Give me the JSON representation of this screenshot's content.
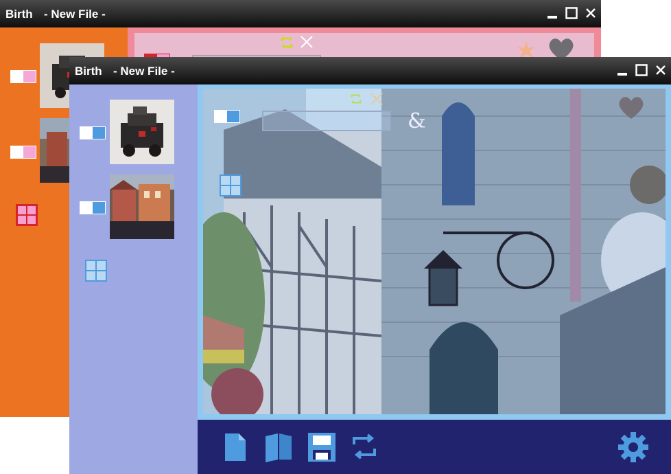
{
  "back_window": {
    "app_name": "Birth",
    "file_name": "- New File -"
  },
  "front_window": {
    "app_name": "Birth",
    "file_name": "- New File -",
    "search_field": {
      "value": "",
      "placeholder": ""
    },
    "amp_label": "&"
  },
  "icons": {
    "window_controls": [
      "minimize-icon",
      "maximize-icon",
      "close-icon"
    ],
    "toolbar": [
      "new-page-icon",
      "open-book-icon",
      "save-icon",
      "refresh-icon",
      "settings-gear-icon"
    ],
    "overlay": [
      "refresh-icon",
      "close-icon",
      "heart-icon"
    ]
  },
  "colors": {
    "back_accent": "#ec7322",
    "back_content": "#f08a98",
    "front_sidebar": "#9ea8e2",
    "front_content_border": "#8fc8f0",
    "bottom_bar": "#22236e",
    "toolbar_icon": "#4f9be0"
  }
}
